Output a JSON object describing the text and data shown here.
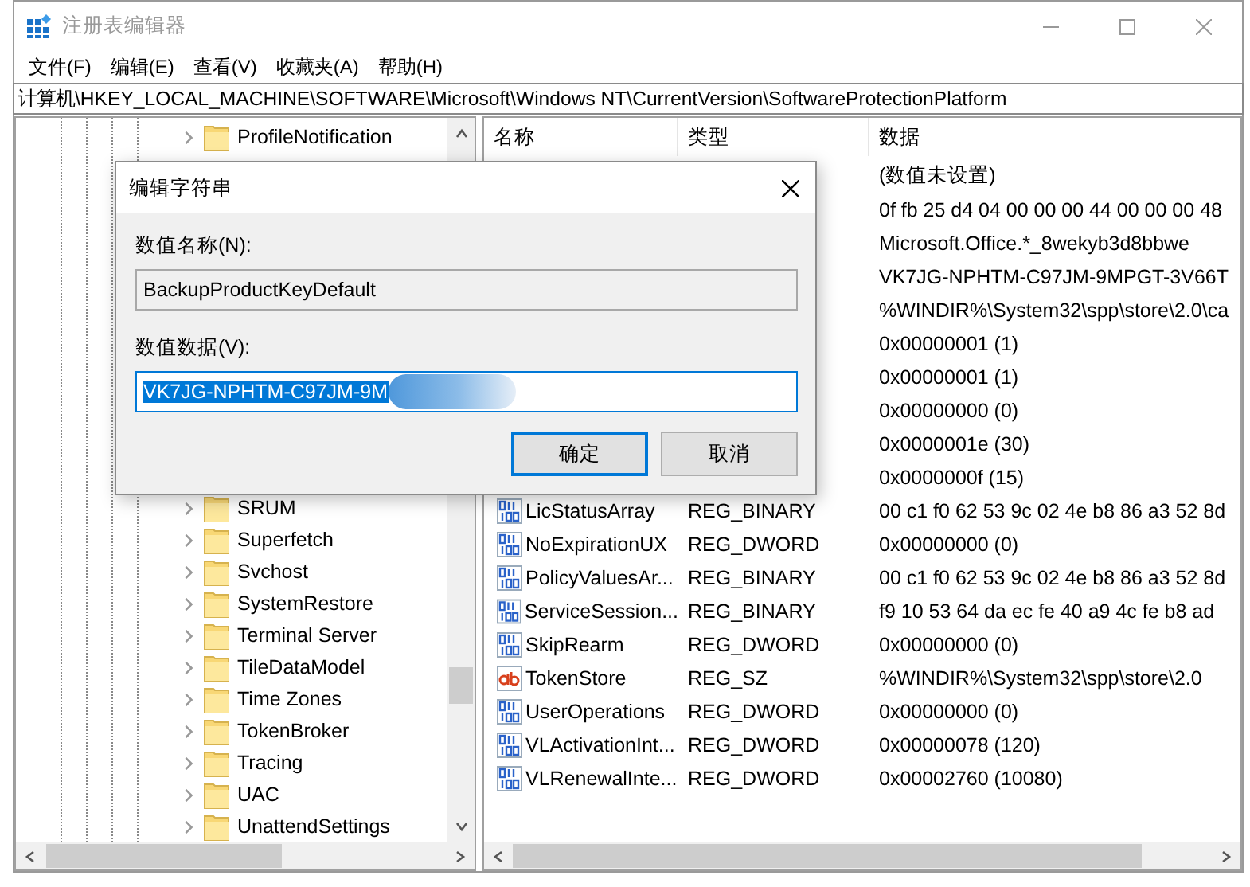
{
  "window": {
    "title": "注册表编辑器",
    "active": false
  },
  "menu": [
    "文件(F)",
    "编辑(E)",
    "查看(V)",
    "收藏夹(A)",
    "帮助(H)"
  ],
  "address": "计算机\\HKEY_LOCAL_MACHINE\\SOFTWARE\\Microsoft\\Windows NT\\CurrentVersion\\SoftwareProtectionPlatform",
  "tree": {
    "rows_above": [
      {
        "label": "ProfileNotification",
        "expanded": false
      }
    ],
    "rows_below": [
      {
        "label": "SRUM",
        "expanded": false
      },
      {
        "label": "Superfetch",
        "expanded": false
      },
      {
        "label": "Svchost",
        "expanded": false
      },
      {
        "label": "SystemRestore",
        "expanded": false
      },
      {
        "label": "Terminal Server",
        "expanded": false
      },
      {
        "label": "TileDataModel",
        "expanded": false
      },
      {
        "label": "Time Zones",
        "expanded": false
      },
      {
        "label": "TokenBroker",
        "expanded": false
      },
      {
        "label": "Tracing",
        "expanded": false
      },
      {
        "label": "UAC",
        "expanded": false
      },
      {
        "label": "UnattendSettings",
        "expanded": false
      }
    ]
  },
  "values": {
    "columns": [
      "名称",
      "类型",
      "数据"
    ],
    "rows": [
      {
        "data": "(数值未设置)"
      },
      {
        "data": "0f fb 25 d4 04 00 00 00 44 00 00 00 48"
      },
      {
        "data": "Microsoft.Office.*_8wekyb3d8bbwe"
      },
      {
        "data": "VK7JG-NPHTM-C97JM-9MPGT-3V66T"
      },
      {
        "data": "%WINDIR%\\System32\\spp\\store\\2.0\\ca"
      },
      {
        "data": "0x00000001 (1)"
      },
      {
        "data": "0x00000001 (1)"
      },
      {
        "data": "0x00000000 (0)"
      },
      {
        "data": "0x0000001e (30)"
      },
      {
        "data": "0x0000000f (15)"
      },
      {
        "kind": "binary",
        "name": "LicStatusArray",
        "type": "REG_BINARY",
        "data": "00 c1 f0 62 53 9c 02 4e b8 86 a3 52 8d"
      },
      {
        "kind": "binary",
        "name": "NoExpirationUX",
        "type": "REG_DWORD",
        "data": "0x00000000 (0)"
      },
      {
        "kind": "binary",
        "name": "PolicyValuesAr...",
        "type": "REG_BINARY",
        "data": "00 c1 f0 62 53 9c 02 4e b8 86 a3 52 8d"
      },
      {
        "kind": "binary",
        "name": "ServiceSession...",
        "type": "REG_BINARY",
        "data": "f9 10 53 64 da ec fe 40 a9 4c fe b8 ad"
      },
      {
        "kind": "binary",
        "name": "SkipRearm",
        "type": "REG_DWORD",
        "data": "0x00000000 (0)"
      },
      {
        "kind": "string",
        "name": "TokenStore",
        "type": "REG_SZ",
        "data": "%WINDIR%\\System32\\spp\\store\\2.0"
      },
      {
        "kind": "binary",
        "name": "UserOperations",
        "type": "REG_DWORD",
        "data": "0x00000000 (0)"
      },
      {
        "kind": "binary",
        "name": "VLActivationInt...",
        "type": "REG_DWORD",
        "data": "0x00000078 (120)"
      },
      {
        "kind": "binary",
        "name": "VLRenewalInte...",
        "type": "REG_DWORD",
        "data": "0x00002760 (10080)"
      }
    ]
  },
  "dialog": {
    "title": "编辑字符串",
    "name_label": "数值名称(N):",
    "name_value": "BackupProductKeyDefault",
    "data_label": "数值数据(V):",
    "data_value": "VK7JG-NPHTM-C97JM-9M",
    "data_selected": true,
    "buttons": [
      {
        "label": "确定",
        "default": true
      },
      {
        "label": "取消",
        "default": false
      }
    ]
  }
}
